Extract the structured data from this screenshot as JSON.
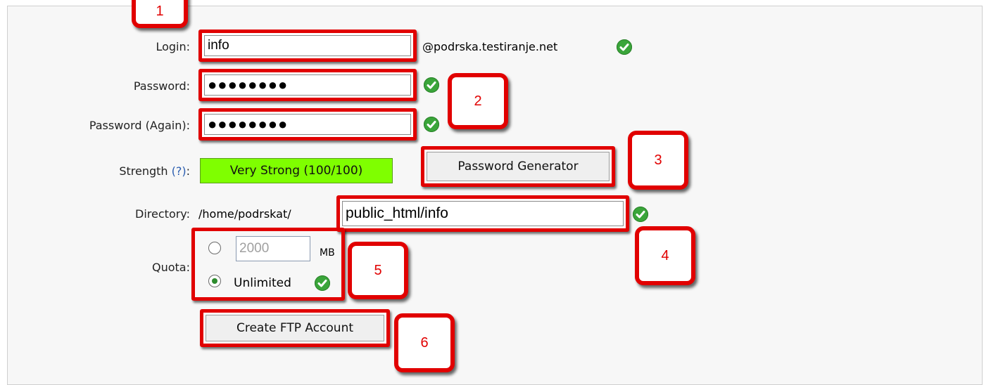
{
  "form": {
    "login": {
      "label": "Login:",
      "value": "info",
      "domain": "@podrska.testiranje.net"
    },
    "password": {
      "label": "Password:",
      "value": "●●●●●●●●"
    },
    "password_again": {
      "label": "Password (Again):",
      "value": "●●●●●●●●"
    },
    "strength": {
      "label": "Strength",
      "help": "(?)",
      "colon": ":",
      "value": "Very Strong (100/100)"
    },
    "password_generator_label": "Password Generator",
    "directory": {
      "label": "Directory:",
      "prefix": "/home/podrskat/",
      "value": "public_html/info"
    },
    "quota": {
      "label": "Quota:",
      "limited_value": "2000",
      "unit": "MB",
      "unlimited_label": "Unlimited"
    },
    "create_button_label": "Create FTP Account"
  },
  "callouts": [
    "1",
    "2",
    "3",
    "4",
    "5",
    "6"
  ],
  "colors": {
    "annotation": "#e10000",
    "strength_bg": "#7fff00",
    "check": "#3aa53a"
  },
  "icons": [
    "check-icon",
    "radio-icon"
  ]
}
